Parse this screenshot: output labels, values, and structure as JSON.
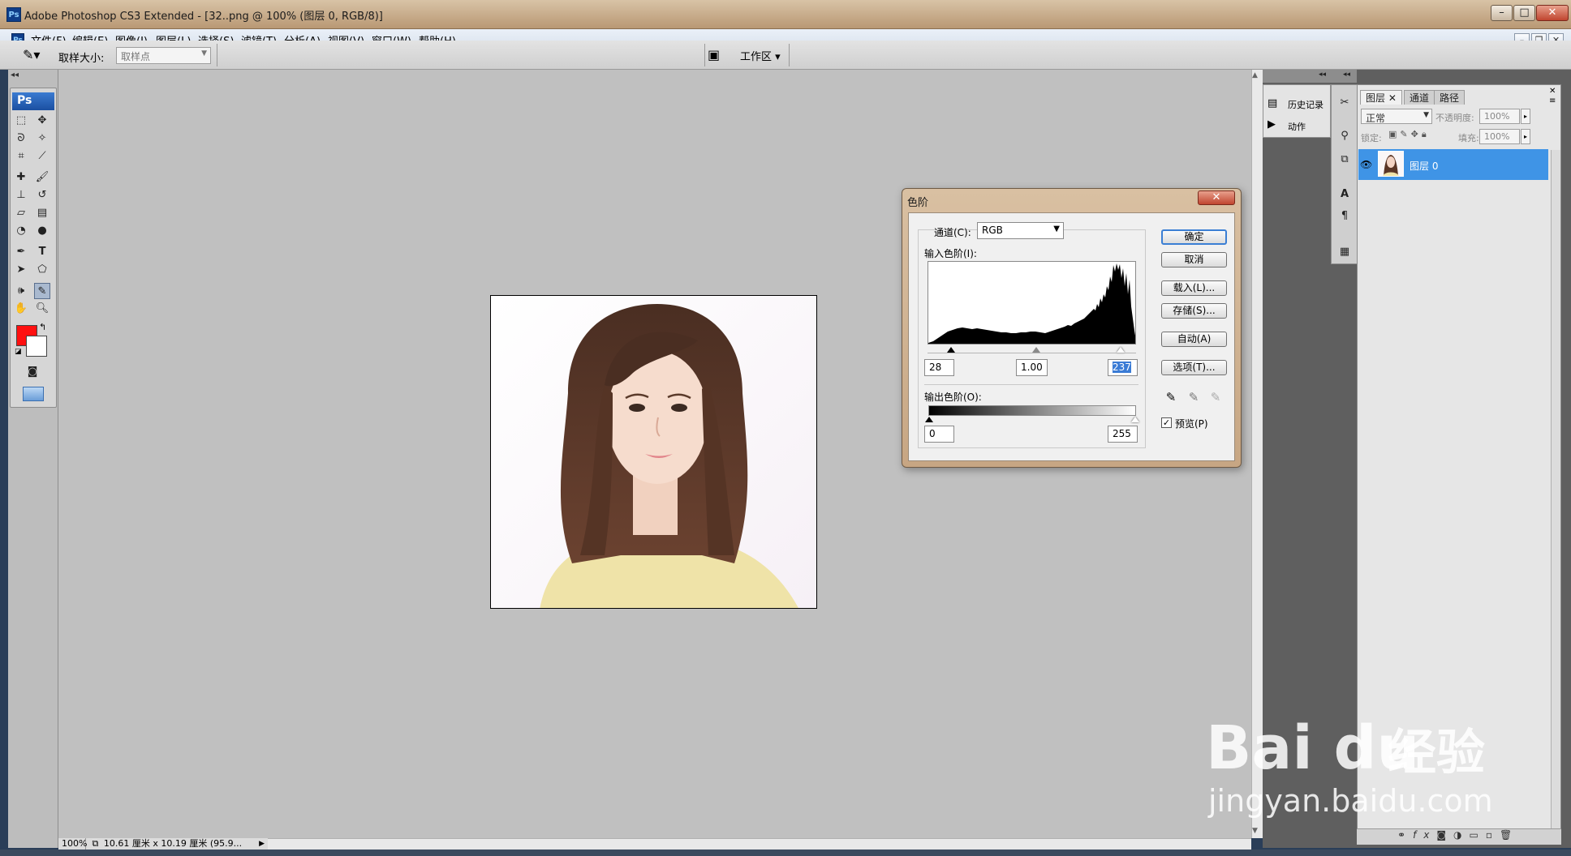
{
  "window": {
    "title": "Adobe Photoshop CS3 Extended - [32..png @ 100% (图层 0, RGB/8)]",
    "app_badge": "Ps",
    "min_label": "–",
    "max_label": "□",
    "close_label": "✕"
  },
  "menu": {
    "items": [
      "文件(F)",
      "编辑(E)",
      "图像(I)",
      "图层(L)",
      "选择(S)",
      "滤镜(T)",
      "分析(A)",
      "视图(V)",
      "窗口(W)",
      "帮助(H)"
    ]
  },
  "options": {
    "sample_size_label": "取样大小:",
    "sample_size_value": "取样点",
    "workspace_label": "工作区"
  },
  "toolbox": {
    "badge": "Ps"
  },
  "status": {
    "zoom": "100%",
    "doc_size": "10.61 厘米 x 10.19 厘米 (95.9..."
  },
  "dock": {
    "history_label": "历史记录",
    "actions_label": "动作"
  },
  "layers_panel": {
    "tabs": [
      "图层",
      "通道",
      "路径"
    ],
    "blend_mode": "正常",
    "opacity_label": "不透明度:",
    "opacity_value": "100%",
    "lock_label": "锁定:",
    "fill_label": "填充:",
    "fill_value": "100%",
    "layer_name": "图层 0"
  },
  "levels_dialog": {
    "title": "色阶",
    "channel_label": "通道(C):",
    "channel_value": "RGB",
    "input_levels_label": "输入色阶(I):",
    "input_black": "28",
    "input_gamma": "1.00",
    "input_white": "237",
    "output_levels_label": "输出色阶(O):",
    "output_black": "0",
    "output_white": "255",
    "buttons": {
      "ok": "确定",
      "cancel": "取消",
      "load": "载入(L)...",
      "save": "存储(S)...",
      "auto": "自动(A)",
      "options": "选项(T)..."
    },
    "preview_label": "预览(P)",
    "preview_checked": true
  },
  "watermark": {
    "logo": "Bai du",
    "cn": "经验",
    "url": "jingyan.baidu.com"
  }
}
